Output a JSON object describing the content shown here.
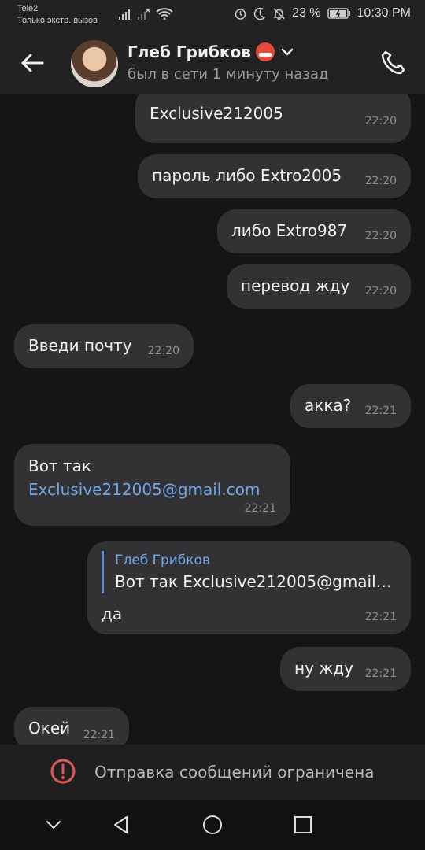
{
  "status_bar": {
    "carrier": "Tele2",
    "carrier_sub": "Только экстр. вызов",
    "battery": "23 %",
    "time": "10:30 PM",
    "icons": [
      "signal-icon",
      "no-signal-icon",
      "wifi-icon",
      "alarm-icon",
      "moon-icon",
      "mute-bell-icon",
      "battery-icon"
    ]
  },
  "header": {
    "contact_name": "Глеб Грибков",
    "presence": "был в сети 1 минуту назад"
  },
  "messages": [
    {
      "text": "Exclusive212005",
      "time": "22:20"
    },
    {
      "text": "пароль либо Extro2005",
      "time": "22:20"
    },
    {
      "text": "либо Extro987",
      "time": "22:20"
    },
    {
      "text": "перевод жду",
      "time": "22:20"
    },
    {
      "text": "Введи почту",
      "time": "22:20"
    },
    {
      "text": "акка?",
      "time": "22:21"
    },
    {
      "line1": "Вот так",
      "link": "Exclusive212005@gmail.com",
      "time": "22:21"
    },
    {
      "reply_name": "Глеб Грибков",
      "reply_text": "Вот так Exclusive212005@gmail....",
      "text": "да",
      "time": "22:21"
    },
    {
      "text": "ну жду",
      "time": "22:21"
    },
    {
      "text": "Окей",
      "time": "22:21"
    }
  ],
  "restriction": {
    "text": "Отправка сообщений ограничена"
  },
  "colors": {
    "background": "#151515",
    "bubble": "#323234",
    "link": "#6fa6e8",
    "warning": "#e15757"
  }
}
